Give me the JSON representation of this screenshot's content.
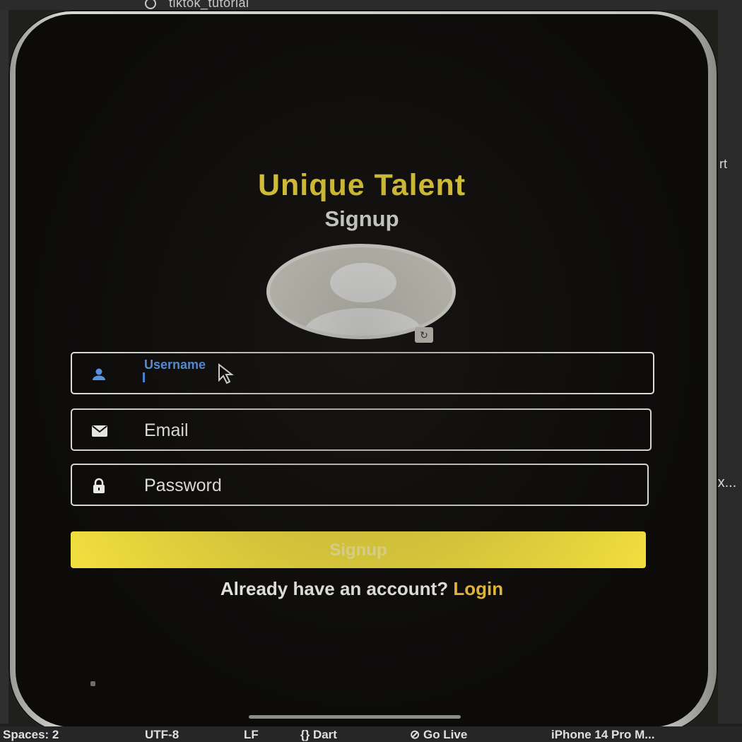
{
  "desktop": {
    "tab_title": "tiktok_tutorial",
    "right_text_1": "rt",
    "right_text_2": "lex..."
  },
  "statusbar": {
    "spaces": "Spaces: 2",
    "encoding": "UTF-8",
    "eol": "LF",
    "language": "{} Dart",
    "golive": "⊘ Go Live",
    "device": "iPhone 14 Pro M..."
  },
  "app": {
    "title": "Unique Talent",
    "subtitle": "Signup"
  },
  "form": {
    "username": {
      "label": "Username",
      "value": ""
    },
    "email": {
      "placeholder": "Email"
    },
    "password": {
      "placeholder": "Password"
    },
    "submit_label": "Signup"
  },
  "footer": {
    "prompt": "Already have an account?",
    "link_label": "Login"
  },
  "colors": {
    "accent": "#f5dd3c",
    "focus": "#5b9cf0",
    "background": "#0c0b0a"
  }
}
